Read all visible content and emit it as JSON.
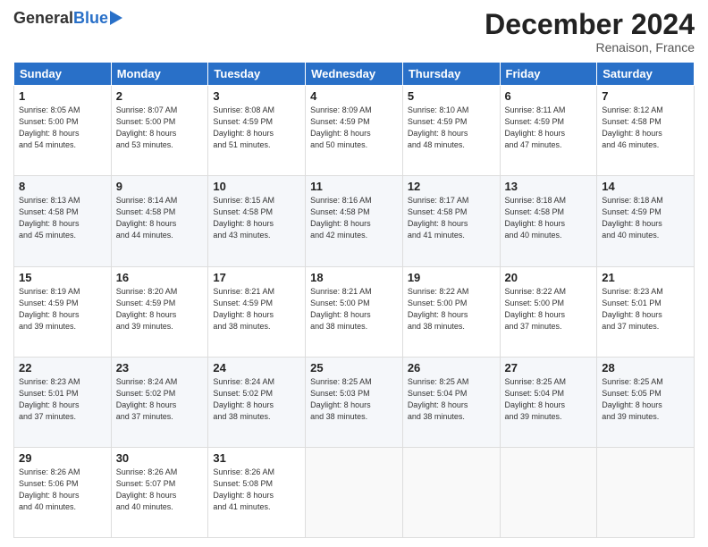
{
  "logo": {
    "general": "General",
    "blue": "Blue"
  },
  "title": "December 2024",
  "subtitle": "Renaison, France",
  "days_header": [
    "Sunday",
    "Monday",
    "Tuesday",
    "Wednesday",
    "Thursday",
    "Friday",
    "Saturday"
  ],
  "weeks": [
    [
      {
        "day": "1",
        "info": "Sunrise: 8:05 AM\nSunset: 5:00 PM\nDaylight: 8 hours\nand 54 minutes."
      },
      {
        "day": "2",
        "info": "Sunrise: 8:07 AM\nSunset: 5:00 PM\nDaylight: 8 hours\nand 53 minutes."
      },
      {
        "day": "3",
        "info": "Sunrise: 8:08 AM\nSunset: 4:59 PM\nDaylight: 8 hours\nand 51 minutes."
      },
      {
        "day": "4",
        "info": "Sunrise: 8:09 AM\nSunset: 4:59 PM\nDaylight: 8 hours\nand 50 minutes."
      },
      {
        "day": "5",
        "info": "Sunrise: 8:10 AM\nSunset: 4:59 PM\nDaylight: 8 hours\nand 48 minutes."
      },
      {
        "day": "6",
        "info": "Sunrise: 8:11 AM\nSunset: 4:59 PM\nDaylight: 8 hours\nand 47 minutes."
      },
      {
        "day": "7",
        "info": "Sunrise: 8:12 AM\nSunset: 4:58 PM\nDaylight: 8 hours\nand 46 minutes."
      }
    ],
    [
      {
        "day": "8",
        "info": "Sunrise: 8:13 AM\nSunset: 4:58 PM\nDaylight: 8 hours\nand 45 minutes."
      },
      {
        "day": "9",
        "info": "Sunrise: 8:14 AM\nSunset: 4:58 PM\nDaylight: 8 hours\nand 44 minutes."
      },
      {
        "day": "10",
        "info": "Sunrise: 8:15 AM\nSunset: 4:58 PM\nDaylight: 8 hours\nand 43 minutes."
      },
      {
        "day": "11",
        "info": "Sunrise: 8:16 AM\nSunset: 4:58 PM\nDaylight: 8 hours\nand 42 minutes."
      },
      {
        "day": "12",
        "info": "Sunrise: 8:17 AM\nSunset: 4:58 PM\nDaylight: 8 hours\nand 41 minutes."
      },
      {
        "day": "13",
        "info": "Sunrise: 8:18 AM\nSunset: 4:58 PM\nDaylight: 8 hours\nand 40 minutes."
      },
      {
        "day": "14",
        "info": "Sunrise: 8:18 AM\nSunset: 4:59 PM\nDaylight: 8 hours\nand 40 minutes."
      }
    ],
    [
      {
        "day": "15",
        "info": "Sunrise: 8:19 AM\nSunset: 4:59 PM\nDaylight: 8 hours\nand 39 minutes."
      },
      {
        "day": "16",
        "info": "Sunrise: 8:20 AM\nSunset: 4:59 PM\nDaylight: 8 hours\nand 39 minutes."
      },
      {
        "day": "17",
        "info": "Sunrise: 8:21 AM\nSunset: 4:59 PM\nDaylight: 8 hours\nand 38 minutes."
      },
      {
        "day": "18",
        "info": "Sunrise: 8:21 AM\nSunset: 5:00 PM\nDaylight: 8 hours\nand 38 minutes."
      },
      {
        "day": "19",
        "info": "Sunrise: 8:22 AM\nSunset: 5:00 PM\nDaylight: 8 hours\nand 38 minutes."
      },
      {
        "day": "20",
        "info": "Sunrise: 8:22 AM\nSunset: 5:00 PM\nDaylight: 8 hours\nand 37 minutes."
      },
      {
        "day": "21",
        "info": "Sunrise: 8:23 AM\nSunset: 5:01 PM\nDaylight: 8 hours\nand 37 minutes."
      }
    ],
    [
      {
        "day": "22",
        "info": "Sunrise: 8:23 AM\nSunset: 5:01 PM\nDaylight: 8 hours\nand 37 minutes."
      },
      {
        "day": "23",
        "info": "Sunrise: 8:24 AM\nSunset: 5:02 PM\nDaylight: 8 hours\nand 37 minutes."
      },
      {
        "day": "24",
        "info": "Sunrise: 8:24 AM\nSunset: 5:02 PM\nDaylight: 8 hours\nand 38 minutes."
      },
      {
        "day": "25",
        "info": "Sunrise: 8:25 AM\nSunset: 5:03 PM\nDaylight: 8 hours\nand 38 minutes."
      },
      {
        "day": "26",
        "info": "Sunrise: 8:25 AM\nSunset: 5:04 PM\nDaylight: 8 hours\nand 38 minutes."
      },
      {
        "day": "27",
        "info": "Sunrise: 8:25 AM\nSunset: 5:04 PM\nDaylight: 8 hours\nand 39 minutes."
      },
      {
        "day": "28",
        "info": "Sunrise: 8:25 AM\nSunset: 5:05 PM\nDaylight: 8 hours\nand 39 minutes."
      }
    ],
    [
      {
        "day": "29",
        "info": "Sunrise: 8:26 AM\nSunset: 5:06 PM\nDaylight: 8 hours\nand 40 minutes."
      },
      {
        "day": "30",
        "info": "Sunrise: 8:26 AM\nSunset: 5:07 PM\nDaylight: 8 hours\nand 40 minutes."
      },
      {
        "day": "31",
        "info": "Sunrise: 8:26 AM\nSunset: 5:08 PM\nDaylight: 8 hours\nand 41 minutes."
      },
      {
        "day": "",
        "info": ""
      },
      {
        "day": "",
        "info": ""
      },
      {
        "day": "",
        "info": ""
      },
      {
        "day": "",
        "info": ""
      }
    ]
  ]
}
